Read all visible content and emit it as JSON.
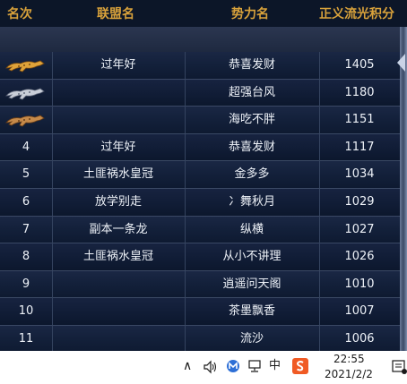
{
  "table": {
    "headers": {
      "rank": "名次",
      "alliance": "联盟名",
      "power": "势力名",
      "score": "正义流光积分"
    },
    "rows": [
      {
        "rank": "",
        "medal": "gold-leopard-icon",
        "alliance": "过年好",
        "power": "恭喜发财",
        "score": "1405"
      },
      {
        "rank": "",
        "medal": "silver-leopard-icon",
        "alliance": "",
        "power": "超强台风",
        "score": "1180"
      },
      {
        "rank": "",
        "medal": "bronze-leopard-icon",
        "alliance": "",
        "power": "海吃不胖",
        "score": "1151"
      },
      {
        "rank": "4",
        "alliance": "过年好",
        "power": "恭喜发财",
        "score": "1117"
      },
      {
        "rank": "5",
        "alliance": "土匪祸水皇冠",
        "power": "金多多",
        "score": "1034"
      },
      {
        "rank": "6",
        "alliance": "放学别走",
        "power": "冫舞秋月",
        "score": "1029"
      },
      {
        "rank": "7",
        "alliance": "副本一条龙",
        "power": "纵横",
        "score": "1027"
      },
      {
        "rank": "8",
        "alliance": "土匪祸水皇冠",
        "power": "从小不讲理",
        "score": "1026"
      },
      {
        "rank": "9",
        "alliance": "",
        "power": "逍遥问天阁",
        "score": "1010"
      },
      {
        "rank": "10",
        "alliance": "",
        "power": "茶墨飘香",
        "score": "1007"
      },
      {
        "rank": "11",
        "alliance": "",
        "power": "流沙",
        "score": "1006"
      }
    ]
  },
  "taskbar": {
    "chevron": "∧",
    "ime_label": "中",
    "time": "22:55",
    "date": "2021/2/2"
  },
  "colors": {
    "header_text": "#d9a23b",
    "gold": "#e0a33a",
    "silver": "#c9ced8",
    "bronze": "#c68a4a"
  }
}
